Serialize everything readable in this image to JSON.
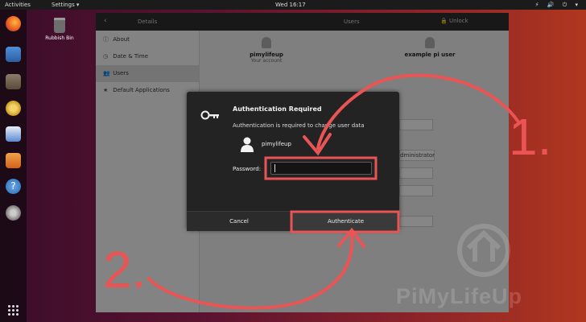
{
  "topbar": {
    "activities": "Activities",
    "app_menu": "Settings ▾",
    "clock": "Wed 16:17",
    "tray": "⚡ 🔊 ⏻ ▾"
  },
  "desktop": {
    "bin_label": "Rubbish Bin"
  },
  "window": {
    "left_title": "Details",
    "right_title": "Users",
    "unlock_label": "🔒 Unlock",
    "sidebar": [
      {
        "icon": "ⓘ",
        "label": "About",
        "selected": false
      },
      {
        "icon": "◷",
        "label": "Date & Time",
        "selected": false
      },
      {
        "icon": "👥",
        "label": "Users",
        "selected": true
      },
      {
        "icon": "★",
        "label": "Default Applications",
        "selected": false
      }
    ],
    "users": [
      {
        "name": "pimylifeup",
        "sub": "Your account"
      },
      {
        "name": "example pi user",
        "sub": ""
      }
    ],
    "partial_label": "dministrator"
  },
  "dialog": {
    "title": "Authentication Required",
    "message": "Authentication is required to change user data",
    "user": "pimylifeup",
    "password_label": "Password:",
    "password_value": "",
    "cancel_label": "Cancel",
    "auth_label": "Authenticate"
  },
  "annotations": {
    "step1": "1.",
    "step2": "2.",
    "color": "#ea5454"
  },
  "watermark": "PiMyLifeUp"
}
